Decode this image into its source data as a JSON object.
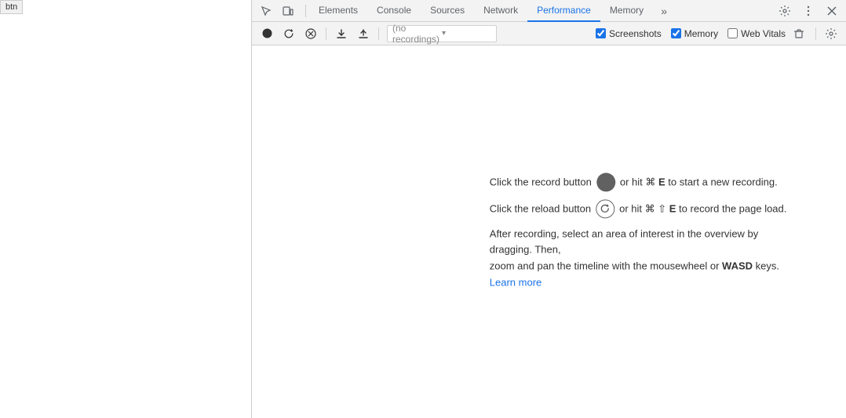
{
  "btn": {
    "label": "btn"
  },
  "tabs": {
    "items": [
      {
        "id": "elements",
        "label": "Elements",
        "active": false
      },
      {
        "id": "console",
        "label": "Console",
        "active": false
      },
      {
        "id": "sources",
        "label": "Sources",
        "active": false
      },
      {
        "id": "network",
        "label": "Network",
        "active": false
      },
      {
        "id": "performance",
        "label": "Performance",
        "active": true
      },
      {
        "id": "memory",
        "label": "Memory",
        "active": false
      }
    ],
    "more_label": "»"
  },
  "toolbar": {
    "no_recordings": "(no recordings)",
    "screenshots_label": "Screenshots",
    "memory_label": "Memory",
    "web_vitals_label": "Web Vitals",
    "screenshots_checked": true,
    "memory_checked": true,
    "web_vitals_checked": false
  },
  "instructions": {
    "record_line1_prefix": "Click the record button",
    "record_line1_suffix": "or hit ⌘ E to start a new recording.",
    "reload_line1_prefix": "Click the reload button",
    "reload_line1_suffix": "or hit ⌘ ⇧ E to record the page load.",
    "after_line1": "After recording, select an area of interest in the overview by dragging. Then,",
    "after_line2_prefix": "zoom and pan the timeline with the mousewheel or ",
    "after_bold": "WASD",
    "after_line2_suffix": " keys.",
    "learn_more": "Learn more"
  }
}
